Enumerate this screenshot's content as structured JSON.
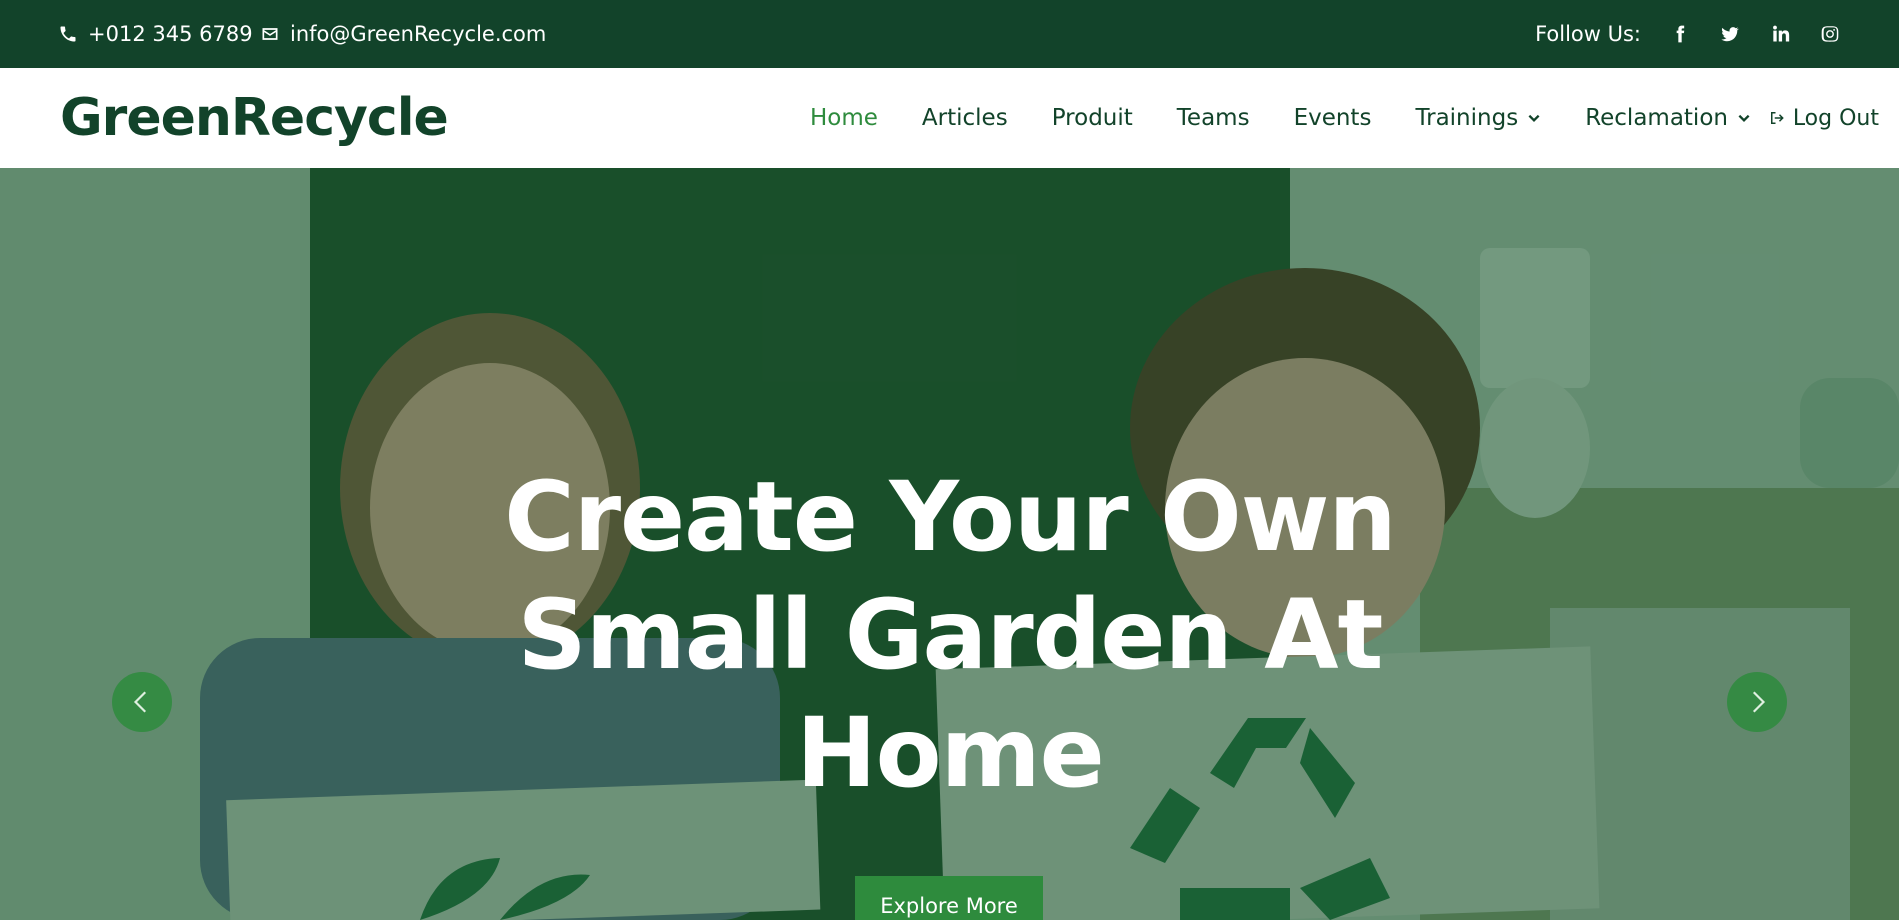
{
  "topbar": {
    "phone": "+012 345 6789",
    "email": "info@GreenRecycle.com",
    "follow_label": "Follow Us:",
    "social_icons": [
      "facebook-icon",
      "twitter-icon",
      "linkedin-icon",
      "instagram-icon"
    ]
  },
  "navbar": {
    "logo": "GreenRecycle",
    "items": [
      {
        "label": "Home",
        "active": true
      },
      {
        "label": "Articles"
      },
      {
        "label": "Produit"
      },
      {
        "label": "Teams"
      },
      {
        "label": "Events"
      },
      {
        "label": "Trainings",
        "dropdown": true
      },
      {
        "label": "Reclamation",
        "dropdown": true
      }
    ],
    "logout": "Log Out"
  },
  "hero": {
    "title": "Create Your Own Small Garden At Home",
    "button": "Explore More"
  },
  "colors": {
    "dark_green": "#12432a",
    "accent_green": "#2e8b3d",
    "white": "#ffffff"
  }
}
